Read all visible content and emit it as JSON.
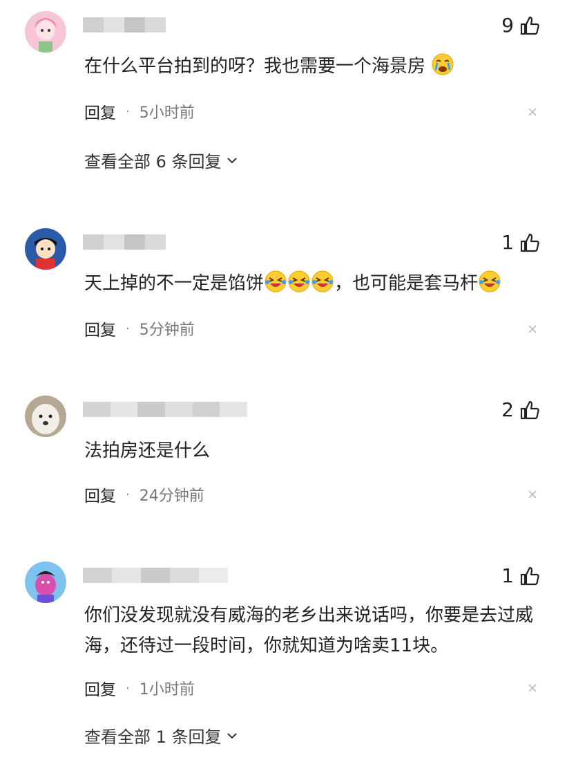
{
  "comments": [
    {
      "likes": "9",
      "text": "在什么平台拍到的呀？我也需要一个海景房",
      "emoji": [
        "cry-face"
      ],
      "reply_label": "回复",
      "time": "5小时前",
      "view_all": "查看全部 6 条回复"
    },
    {
      "likes": "1",
      "text_part1": "天上掉的不一定是馅饼",
      "text_part2": "，也可能是套马杆",
      "emoji": [
        "laugh-cry-face",
        "laugh-cry-face",
        "laugh-cry-face",
        "laugh-cry-face"
      ],
      "reply_label": "回复",
      "time": "5分钟前"
    },
    {
      "likes": "2",
      "text": "法拍房还是什么",
      "reply_label": "回复",
      "time": "24分钟前"
    },
    {
      "likes": "1",
      "text": "你们没发现就没有威海的老乡出来说话吗，你要是去过威海，还待过一段时间，你就知道为啥卖11块。",
      "reply_label": "回复",
      "time": "1小时前",
      "view_all": "查看全部 1 条回复"
    }
  ],
  "colors": {
    "text": "#222222",
    "meta": "#777777",
    "blur": "#d8d8d8"
  }
}
